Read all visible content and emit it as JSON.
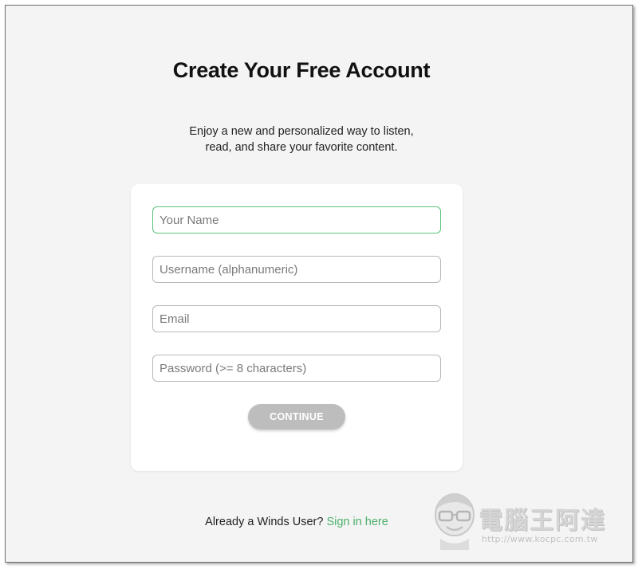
{
  "page": {
    "title": "Create Your Free Account",
    "subtitle_line1": "Enjoy a new and personalized way to listen,",
    "subtitle_line2": "read, and share your favorite content."
  },
  "form": {
    "name_placeholder": "Your Name",
    "username_placeholder": "Username (alphanumeric)",
    "email_placeholder": "Email",
    "password_placeholder": "Password (>= 8 characters)",
    "continue_label": "CONTINUE"
  },
  "footer": {
    "already_text": "Already a Winds User?",
    "signin_link": "Sign in here"
  },
  "watermark": {
    "text": "電腦王阿達",
    "url": "http://www.kocpc.com.tw"
  },
  "colors": {
    "background": "#f4f4f4",
    "card": "#ffffff",
    "focus_border": "#5cc47a",
    "link": "#4caf6a",
    "button_disabled": "#bdbdbd"
  }
}
